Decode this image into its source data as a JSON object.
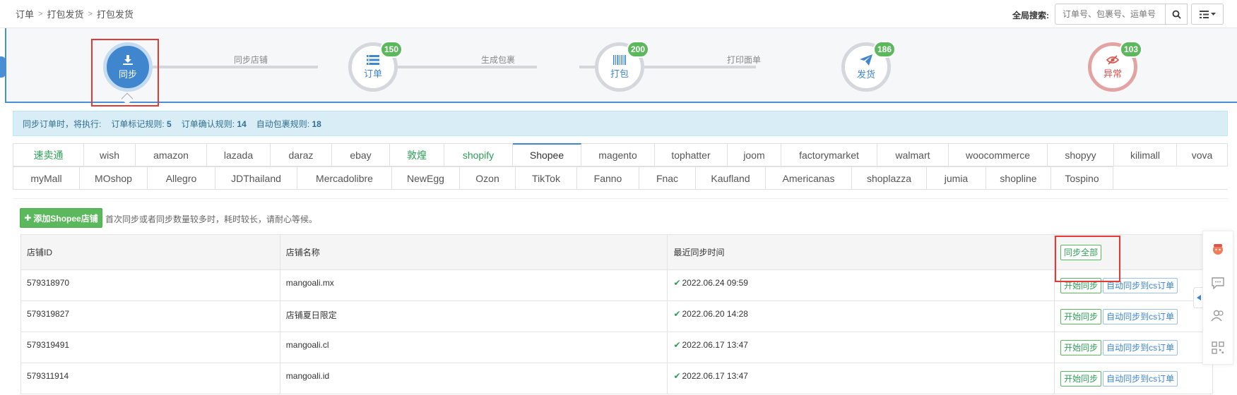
{
  "breadcrumb": [
    "订单",
    "打包发货",
    "打包发货"
  ],
  "global_search": {
    "label": "全局搜索:",
    "placeholder": "订单号、包裹号、运单号"
  },
  "workflow": {
    "steps": [
      {
        "label": "同步",
        "icon": "download-icon",
        "badge": ""
      },
      {
        "label": "订单",
        "icon": "list-icon",
        "badge": "150"
      },
      {
        "label": "打包",
        "icon": "barcode-icon",
        "badge": "200"
      },
      {
        "label": "发货",
        "icon": "paper-plane-icon",
        "badge": "186"
      },
      {
        "label": "异常",
        "icon": "eye-slash-icon",
        "badge": "103"
      }
    ],
    "connectors": [
      "同步店铺",
      "生成包裹",
      "打印面单"
    ]
  },
  "info": {
    "prefix": "同步订单时，将执行:",
    "rule1_label": "订单标记规则:",
    "rule1_value": "5",
    "rule2_label": "订单确认规则:",
    "rule2_value": "14",
    "rule3_label": "自动包裹规则:",
    "rule3_value": "18"
  },
  "platforms": {
    "row1": [
      "速卖通",
      "wish",
      "amazon",
      "lazada",
      "daraz",
      "ebay",
      "敦煌",
      "shopify",
      "Shopee",
      "magento",
      "tophatter",
      "joom",
      "factorymarket",
      "walmart",
      "woocommerce",
      "shopyy",
      "kilimall",
      "vova"
    ],
    "row2": [
      "myMall",
      "MOshop",
      "Allegro",
      "JDThailand",
      "Mercadolibre",
      "NewEgg",
      "Ozon",
      "TikTok",
      "Fanno",
      "Fnac",
      "Kaufland",
      "Americanas",
      "shoplazza",
      "jumia",
      "shopline",
      "Tospino"
    ],
    "active": "Shopee"
  },
  "panel": {
    "add_button": "添加Shopee店铺",
    "note": "首次同步或者同步数量较多时，耗时较长，请耐心等候。"
  },
  "table": {
    "headers": [
      "店铺ID",
      "店铺名称",
      "最近同步时间",
      ""
    ],
    "sync_all": "同步全部",
    "start_sync": "开始同步",
    "auto_sync": "自动同步到cs订单",
    "rows": [
      {
        "id": "579318970",
        "name": "mangoali.mx",
        "time": "2022.06.24 09:59"
      },
      {
        "id": "579319827",
        "name": "店铺夏日限定",
        "time": "2022.06.20 14:28"
      },
      {
        "id": "579319491",
        "name": "mangoali.cl",
        "time": "2022.06.17 13:47"
      },
      {
        "id": "579311914",
        "name": "mangoali.id",
        "time": "2022.06.17 13:47"
      }
    ]
  },
  "colors": {
    "primary": "#3f86cf",
    "success": "#5cb85c",
    "danger": "#d9534f",
    "highlight": "#e53935"
  }
}
